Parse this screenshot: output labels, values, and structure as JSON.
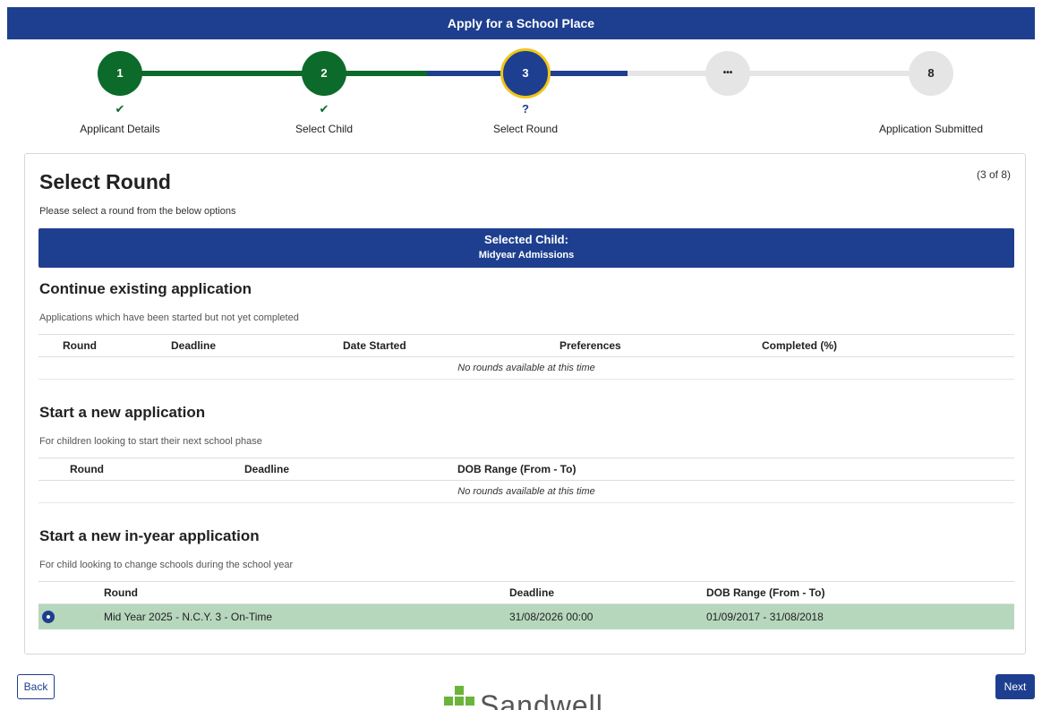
{
  "header": {
    "title": "Apply for a School Place"
  },
  "stepper": {
    "steps": [
      {
        "number": "1",
        "status_icon": "✔",
        "label": "Applicant Details"
      },
      {
        "number": "2",
        "status_icon": "✔",
        "label": "Select Child"
      },
      {
        "number": "3",
        "status_icon": "?",
        "label": "Select Round"
      },
      {
        "number": "•••",
        "status_icon": "",
        "label": ""
      },
      {
        "number": "8",
        "status_icon": "",
        "label": "Application Submitted"
      }
    ],
    "colors": {
      "done": "#0c6b2a",
      "current": "#1e3f8f",
      "current_ring": "#f2c515",
      "future": "#e5e5e5"
    }
  },
  "page": {
    "title": "Select Round",
    "count": "(3 of 8)",
    "instruction": "Please select a round from the below options"
  },
  "selected_child": {
    "label": "Selected Child:",
    "name": "Midyear Admissions"
  },
  "sections": {
    "existing": {
      "title": "Continue existing application",
      "description": "Applications which have been started but not yet completed",
      "columns": [
        "Round",
        "Deadline",
        "Date Started",
        "Preferences",
        "Completed (%)"
      ],
      "empty_text": "No rounds available at this time"
    },
    "new": {
      "title": "Start a new application",
      "description": "For children looking to start their next school phase",
      "columns": [
        "Round",
        "Deadline",
        "DOB Range (From - To)"
      ],
      "empty_text": "No rounds available at this time"
    },
    "inyear": {
      "title": "Start a new in-year application",
      "description": "For child looking to change schools during the school year",
      "columns": [
        "Round",
        "Deadline",
        "DOB Range (From - To)"
      ],
      "rows": [
        {
          "round": "Mid Year 2025 - N.C.Y. 3 - On-Time",
          "deadline": "31/08/2026 00:00",
          "dob_range": "01/09/2017 - 31/08/2018",
          "selected": true
        }
      ]
    }
  },
  "buttons": {
    "back": "Back",
    "next": "Next"
  },
  "footer": {
    "logo_text": "Sandwell"
  }
}
